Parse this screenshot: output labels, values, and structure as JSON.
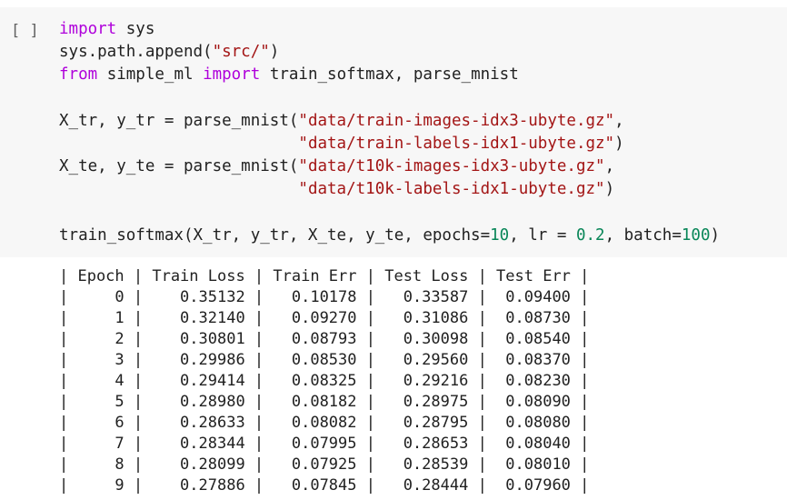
{
  "cell": {
    "run_button": "[ ]",
    "code": {
      "line1": {
        "kw_import": "import",
        "rest": " sys"
      },
      "line2": {
        "pre": "sys.path.append(",
        "str": "\"src/\"",
        "post": ")"
      },
      "line3": {
        "kw_from": "from",
        "mid": " simple_ml ",
        "kw_import": "import",
        "rest": " train_softmax, parse_mnist"
      },
      "line5": {
        "pre": "X_tr, y_tr = parse_mnist(",
        "str": "\"data/train-images-idx3-ubyte.gz\"",
        "post": ","
      },
      "line6": {
        "indent": "                         ",
        "str": "\"data/train-labels-idx1-ubyte.gz\"",
        "post": ")"
      },
      "line7": {
        "pre": "X_te, y_te = parse_mnist(",
        "str": "\"data/t10k-images-idx3-ubyte.gz\"",
        "post": ","
      },
      "line8": {
        "indent": "                         ",
        "str": "\"data/t10k-labels-idx1-ubyte.gz\"",
        "post": ")"
      },
      "line10": {
        "pre": "train_softmax(X_tr, y_tr, X_te, y_te, epochs=",
        "epochs": "10",
        "lr_pre": ", lr = ",
        "lr": "0.2",
        "batch_pre": ", batch=",
        "batch": "100",
        "post": ")"
      }
    }
  },
  "output": {
    "header": "| Epoch | Train Loss | Train Err | Test Loss | Test Err |",
    "rows": [
      "|     0 |    0.35132 |   0.10178 |   0.33587 |  0.09400 |",
      "|     1 |    0.32140 |   0.09270 |   0.31086 |  0.08730 |",
      "|     2 |    0.30801 |   0.08793 |   0.30098 |  0.08540 |",
      "|     3 |    0.29986 |   0.08530 |   0.29560 |  0.08370 |",
      "|     4 |    0.29414 |   0.08325 |   0.29216 |  0.08230 |",
      "|     5 |    0.28980 |   0.08182 |   0.28975 |  0.08090 |",
      "|     6 |    0.28633 |   0.08082 |   0.28795 |  0.08080 |",
      "|     7 |    0.28344 |   0.07995 |   0.28653 |  0.08040 |",
      "|     8 |    0.28099 |   0.07925 |   0.28539 |  0.08010 |",
      "|     9 |    0.27886 |   0.07845 |   0.28444 |  0.07960 |"
    ]
  },
  "colors": {
    "keyword": "#af00db",
    "string": "#a31515",
    "number": "#098658",
    "cell_background": "#f7f7f7"
  }
}
